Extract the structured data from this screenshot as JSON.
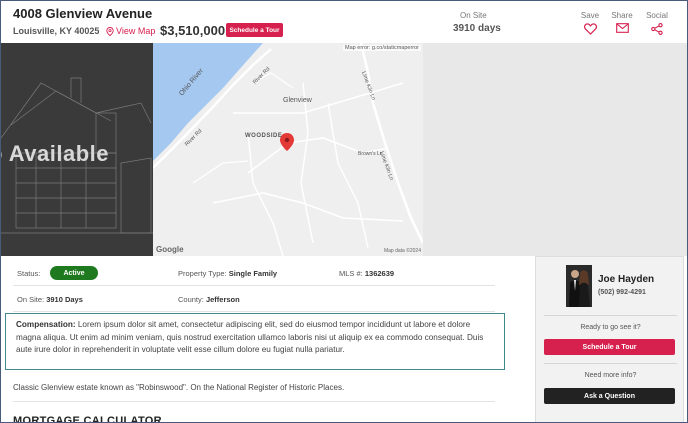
{
  "header": {
    "address": "4008 Glenview Avenue",
    "city": "Louisville, KY 40025",
    "view_map": "View Map",
    "price": "$3,510,000",
    "schedule_tour": "Schedule a Tour",
    "on_site_label": "On Site",
    "on_site_value": "3910 days",
    "actions": {
      "save": "Save",
      "share": "Share",
      "social": "Social"
    }
  },
  "media": {
    "photo_placeholder": "o Available",
    "map": {
      "error": "Map error: g.co/staticmaperror",
      "labels": {
        "glenview": "Glenview",
        "woodside": "WOODSIDE",
        "ohio_river": "Ohio River",
        "river_rd": "River Rd",
        "lime_kiln": "Lime Kiln Ln",
        "brown": "Brown's Ln"
      },
      "google": "Google",
      "map_data": "Map data ©2024"
    }
  },
  "details": {
    "status_label": "Status:",
    "status_value": "Active",
    "property_type_label": "Property Type:",
    "property_type_value": "Single Family",
    "mls_label": "MLS #:",
    "mls_value": "1362639",
    "on_site_label": "On Site:",
    "on_site_value": "3910 Days",
    "county_label": "County:",
    "county_value": "Jefferson",
    "compensation_label": "Compensation:",
    "compensation_text": "Lorem ipsum dolor sit amet, consectetur adipiscing elit, sed do eiusmod tempor incididunt ut labore et dolore magna aliqua. Ut enim ad minim veniam, quis nostrud exercitation ullamco laboris nisi ut aliquip ex ea commodo consequat. Duis aute irure dolor in reprehenderit in voluptate velit esse cillum dolore eu fugiat nulla pariatur.",
    "description": "Classic Glenview estate known as \"Robinswood\". On the National Register of Historic Places.",
    "mortgage_heading": "MORTGAGE CALCULATOR"
  },
  "agent": {
    "name": "Joe Hayden",
    "phone": "(502) 992-4291",
    "question1": "Ready to go see it?",
    "button1": "Schedule a Tour",
    "question2": "Need more info?",
    "button2": "Ask a Question"
  },
  "colors": {
    "accent": "#d6204e",
    "status_active": "#1f7a1f",
    "compensation_border": "#3e8a8a"
  }
}
